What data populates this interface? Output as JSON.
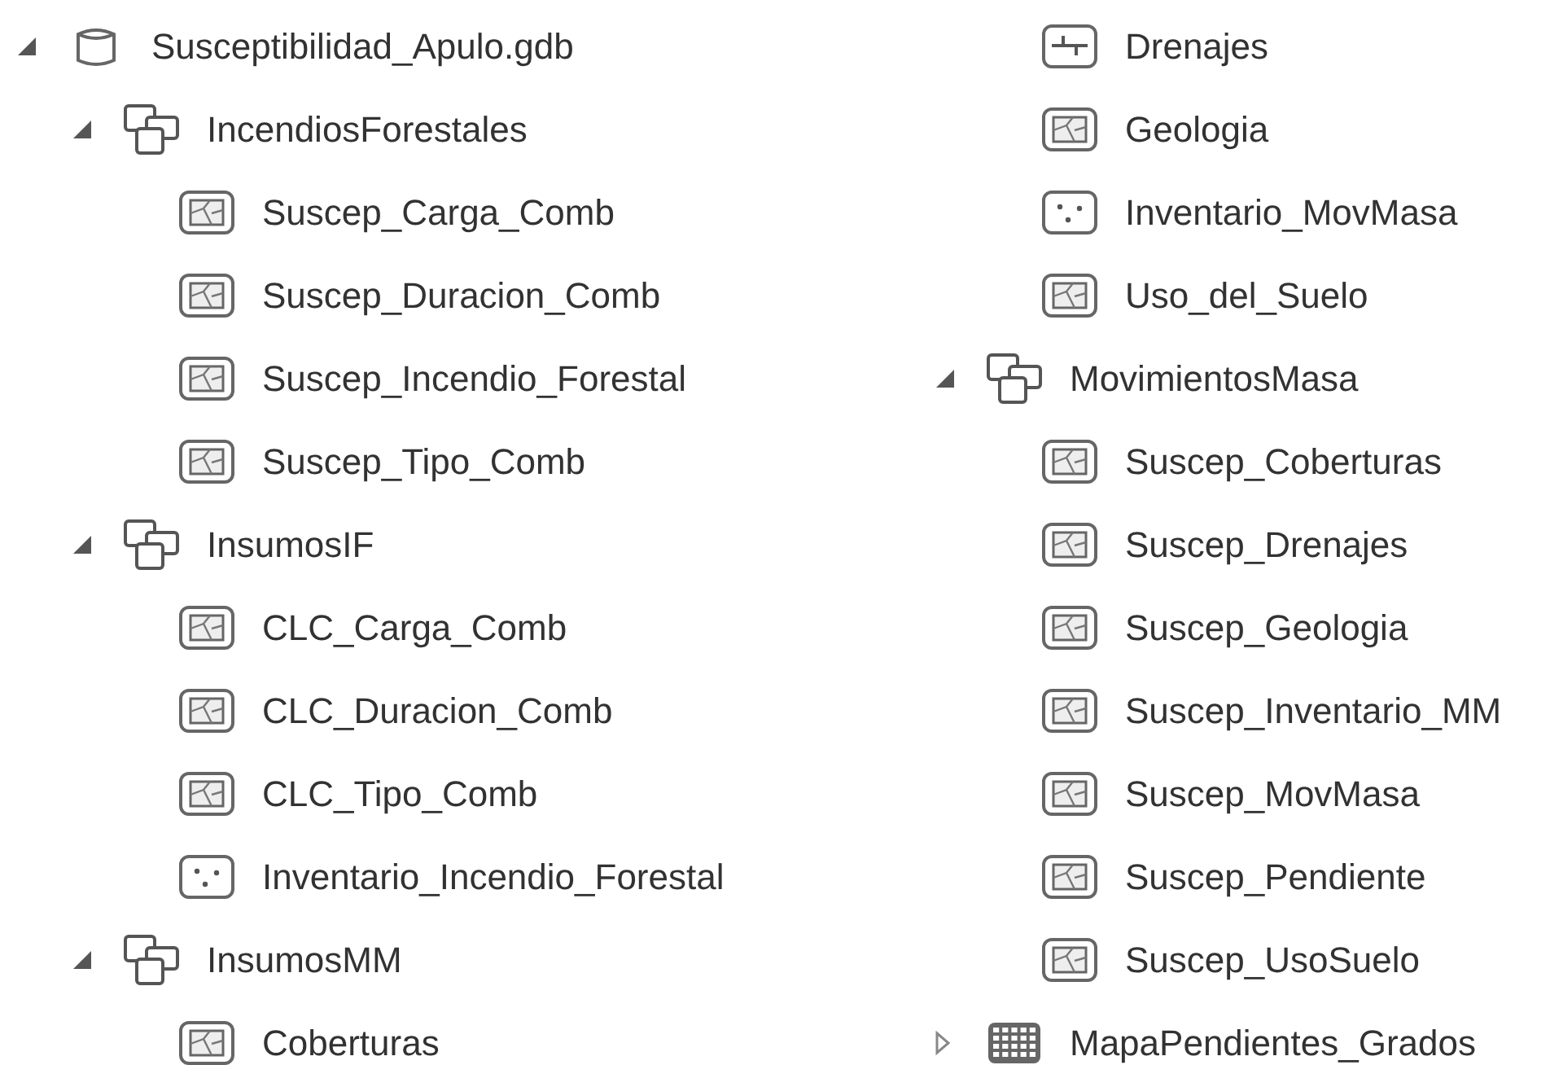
{
  "catalog": {
    "items": [
      {
        "name": "Susceptibilidad_Apulo.gdb",
        "kind": "database",
        "expanded": true,
        "children": [
          {
            "name": "IncendiosForestales",
            "kind": "dataset",
            "expanded": true,
            "children": [
              {
                "name": "Suscep_Carga_Comb",
                "kind": "polygon"
              },
              {
                "name": "Suscep_Duracion_Comb",
                "kind": "polygon"
              },
              {
                "name": "Suscep_Incendio_Forestal",
                "kind": "polygon"
              },
              {
                "name": "Suscep_Tipo_Comb",
                "kind": "polygon"
              }
            ]
          },
          {
            "name": "InsumosIF",
            "kind": "dataset",
            "expanded": true,
            "children": [
              {
                "name": "CLC_Carga_Comb",
                "kind": "polygon"
              },
              {
                "name": "CLC_Duracion_Comb",
                "kind": "polygon"
              },
              {
                "name": "CLC_Tipo_Comb",
                "kind": "polygon"
              },
              {
                "name": "Inventario_Incendio_Forestal",
                "kind": "point"
              }
            ]
          },
          {
            "name": "InsumosMM",
            "kind": "dataset",
            "expanded": true,
            "children": [
              {
                "name": "Coberturas",
                "kind": "polygon"
              },
              {
                "name": "Drenajes",
                "kind": "line"
              },
              {
                "name": "Geologia",
                "kind": "polygon"
              },
              {
                "name": "Inventario_MovMasa",
                "kind": "point"
              },
              {
                "name": "Uso_del_Suelo",
                "kind": "polygon"
              }
            ]
          },
          {
            "name": "MovimientosMasa",
            "kind": "dataset",
            "expanded": true,
            "children": [
              {
                "name": "Suscep_Coberturas",
                "kind": "polygon"
              },
              {
                "name": "Suscep_Drenajes",
                "kind": "polygon"
              },
              {
                "name": "Suscep_Geologia",
                "kind": "polygon"
              },
              {
                "name": "Suscep_Inventario_MM",
                "kind": "polygon"
              },
              {
                "name": "Suscep_MovMasa",
                "kind": "polygon"
              },
              {
                "name": "Suscep_Pendiente",
                "kind": "polygon"
              },
              {
                "name": "Suscep_UsoSuelo",
                "kind": "polygon"
              }
            ]
          },
          {
            "name": "MapaPendientes_Grados",
            "kind": "raster",
            "expanded": false
          }
        ]
      }
    ]
  }
}
